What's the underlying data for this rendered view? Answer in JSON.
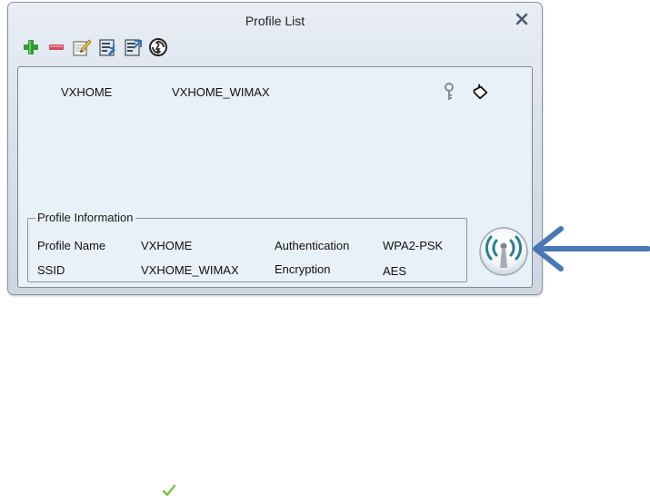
{
  "window": {
    "title": "Profile List"
  },
  "toolbar": {
    "icons": [
      "add-icon",
      "remove-icon",
      "edit-icon",
      "import-icon",
      "export-icon",
      "scan-icon"
    ]
  },
  "profiles": [
    {
      "name": "VXHOME",
      "ssid": "VXHOME_WIMAX"
    }
  ],
  "profile_info": {
    "legend": "Profile Information",
    "profile_name_label": "Profile Name",
    "profile_name_value": "VXHOME",
    "ssid_label": "SSID",
    "ssid_value": "VXHOME_WIMAX",
    "authentication_label": "Authentication",
    "authentication_value": "WPA2-PSK",
    "encryption_label": "Encryption",
    "encryption_value": "AES"
  },
  "colors": {
    "accent_blue": "#4a78b5",
    "add_green": "#2f9a2f",
    "remove_red": "#d3485b",
    "signal_teal": "#2b7f90",
    "check_green": "#7cc142"
  }
}
